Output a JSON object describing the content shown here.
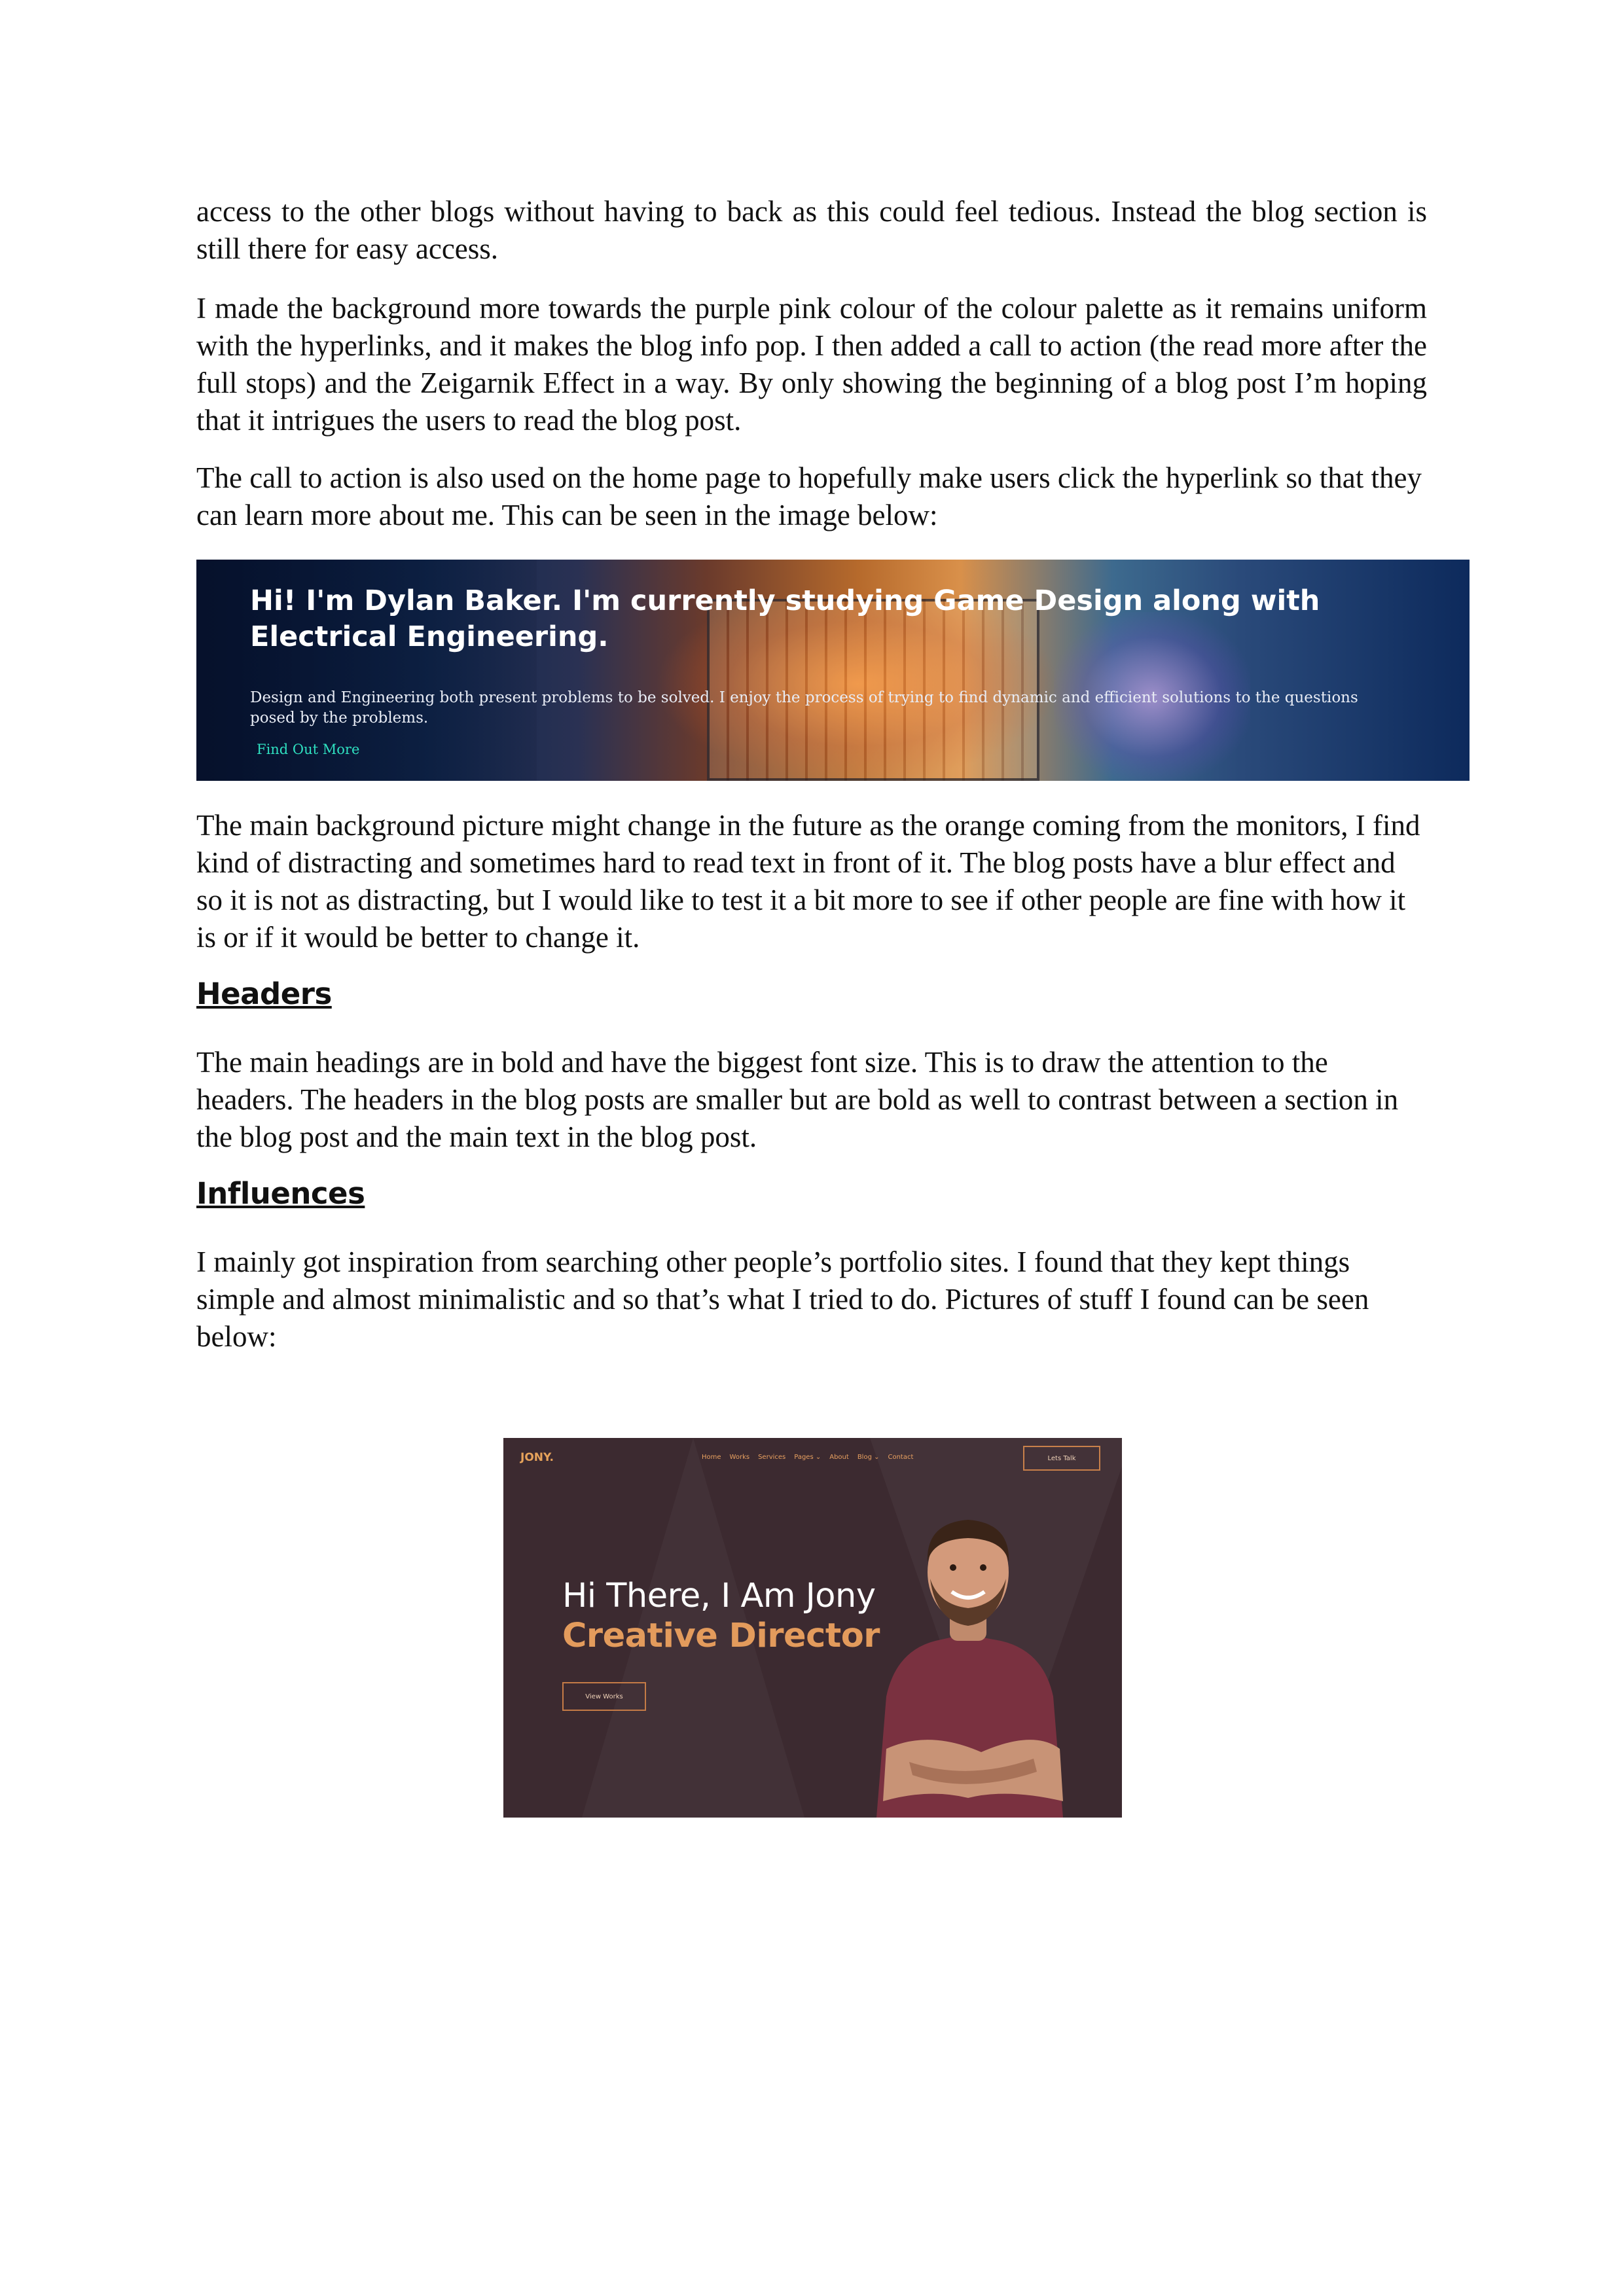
{
  "paragraphs": {
    "p1": "access to the other blogs without having to back as this could feel tedious. Instead the blog section is still there for easy access.",
    "p2": "I made the background more towards the purple pink colour of the colour palette as it remains uniform with the hyperlinks, and it makes the blog info pop. I then added a call to action (the read more after the full stops) and the Zeigarnik Effect in a way. By only showing the beginning of a blog post I’m hoping that it intrigues the users to read the blog post.",
    "p3": "The call to action is also used on the home page to hopefully make users click the hyperlink so that they can learn more about me. This can be seen in the image below:",
    "p4": "The main background picture might change in the future as the orange coming from the monitors, I find kind of distracting and sometimes hard to read text in front of it. The blog posts have a blur effect and so it is not as distracting, but I would like to test it a bit more to see if other people are fine with how it is or if it would be better to change it.",
    "p5": "The main headings are in bold and have the biggest font size. This is to draw the attention to the headers. The headers in the blog posts are smaller but are bold as well to contrast between a section in the blog post and the main text in the blog post.",
    "p6": "I mainly got inspiration from searching other people’s portfolio sites. I found that they kept things simple and almost minimalistic and so that’s what I tried to do. Pictures of stuff I found can be seen below:"
  },
  "headings": {
    "headers": "Headers",
    "influences": "Influences"
  },
  "banner": {
    "title": "Hi! I'm Dylan Baker. I'm currently studying Game Design along with Electrical Engineering.",
    "text": "Design and Engineering both present problems to be solved. I enjoy the process of trying to find dynamic and efficient solutions to the questions posed by the problems.",
    "link": "Find Out More"
  },
  "jony": {
    "logo": "JONY.",
    "nav": [
      "Home",
      "Works",
      "Services",
      "Pages ⌄",
      "About",
      "Blog ⌄",
      "Contact"
    ],
    "cta": "Lets Talk",
    "title_line1": "Hi There, I Am Jony",
    "title_line2": "Creative Director",
    "button": "View Works"
  }
}
